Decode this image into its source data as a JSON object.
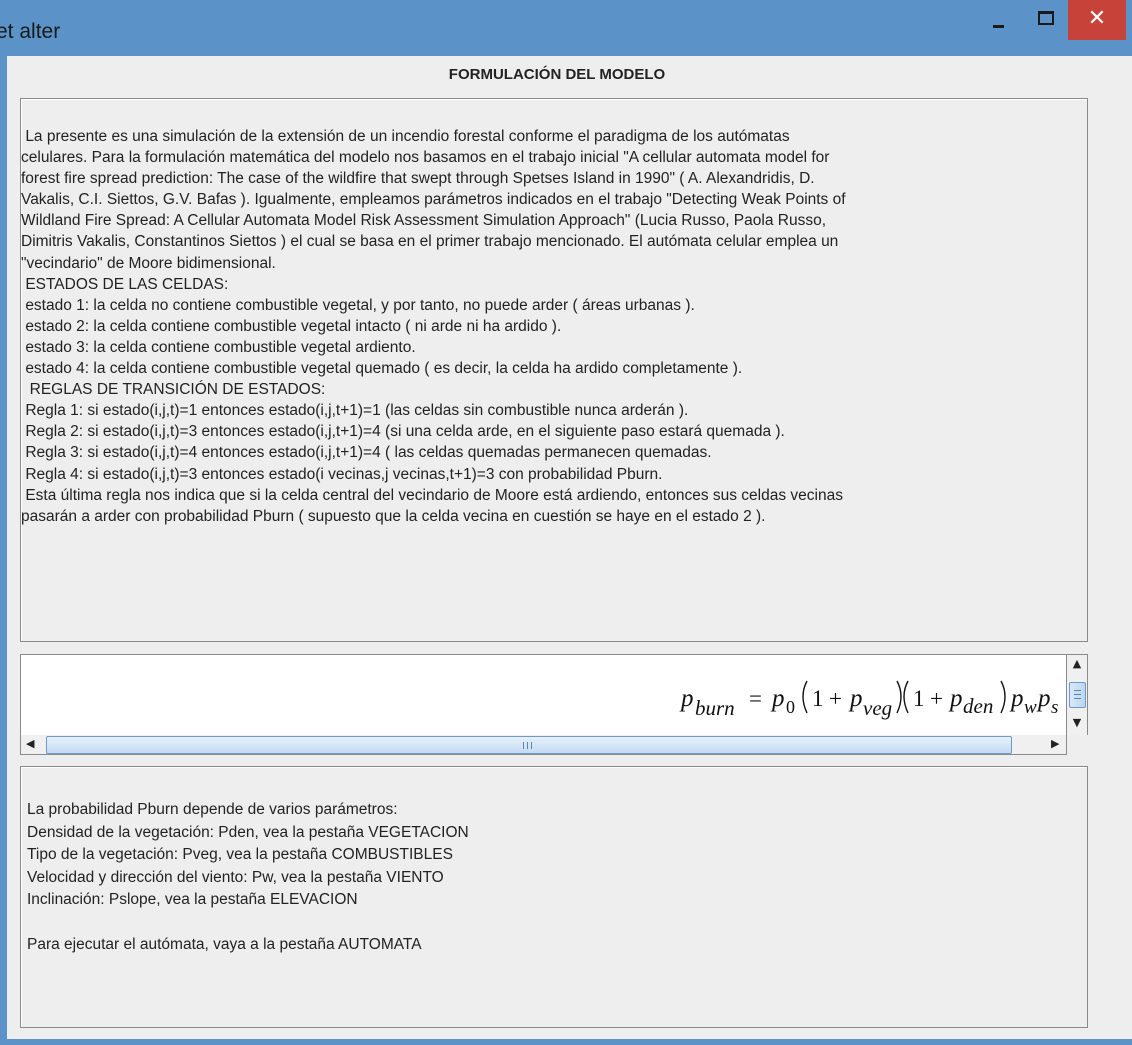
{
  "window": {
    "title": "et alter",
    "minimize_glyph": "−",
    "maximize_glyph": "□",
    "close_glyph": "✕",
    "close_color": "#c7433a",
    "frame_color": "#5b93c9"
  },
  "heading": "FORMULACIÓN DEL MODELO",
  "intro": {
    "lines": [
      " La presente es una simulación de la extensión de un incendio forestal conforme el paradigma de los autómatas",
      "celulares. Para la formulación matemática del modelo nos basamos en el trabajo inicial \"A cellular automata model for",
      "forest fire spread prediction: The case of the wildfire that swept through Spetses Island in 1990\" ( A. Alexandridis, D.",
      "Vakalis, C.I. Siettos, G.V. Bafas ). Igualmente, empleamos parámetros indicados en el trabajo \"Detecting Weak Points of",
      "Wildland Fire Spread: A Cellular Automata Model Risk Assessment Simulation Approach\" (Lucia Russo, Paola Russo,",
      "Dimitris Vakalis, Constantinos Siettos ) el cual se basa en el primer trabajo mencionado. El autómata celular emplea un",
      "\"vecindario\" de Moore bidimensional.",
      " ESTADOS DE LAS CELDAS:",
      " estado 1: la celda no contiene combustible vegetal, y por tanto, no puede arder ( áreas urbanas ).",
      " estado 2: la celda contiene combustible vegetal intacto ( ni arde ni ha ardido ).",
      " estado 3: la celda contiene combustible vegetal ardiento.",
      " estado 4: la celda contiene combustible vegetal quemado ( es decir, la celda ha ardido completamente ).",
      "  REGLAS DE TRANSICIÓN DE ESTADOS:",
      " Regla 1: si estado(i,j,t)=1 entonces estado(i,j,t+1)=1 (las celdas sin combustible nunca arderán ).",
      " Regla 2: si estado(i,j,t)=3 entonces estado(i,j,t+1)=4 (si una celda arde, en el siguiente paso estará quemada ).",
      " Regla 3: si estado(i,j,t)=4 entonces estado(i,j,t+1)=4 ( las celdas quemadas permanecen quemadas.",
      " Regla 4: si estado(i,j,t)=3 entonces estado(i vecinas,j vecinas,t+1)=3 con probabilidad Pburn.",
      " Esta última regla nos indica que si la celda central del vecindario de Moore está ardiendo, entonces sus celdas vecinas",
      "pasarán a arder con probabilidad Pburn ( supuesto que la celda vecina en cuestión se haye en el estado 2 )."
    ]
  },
  "formula": {
    "lhs_base": "p",
    "lhs_sub": "burn",
    "equals": "=",
    "p0_base": "p",
    "p0_sub": "0",
    "one_a": "1",
    "plus_a": "+",
    "pveg_base": "p",
    "pveg_sub": "veg",
    "one_b": "1",
    "plus_b": "+",
    "pden_base": "p",
    "pden_sub": "den",
    "pw_base": "p",
    "pw_sub": "w",
    "ps_base": "p",
    "ps_sub": "s"
  },
  "scrollbars": {
    "up_arrow": "▲",
    "down_arrow": "▼",
    "left_arrow": "◀",
    "right_arrow": "▶"
  },
  "info": {
    "lines": [
      "La probabilidad Pburn depende de varios parámetros:",
      "Densidad de la vegetación: Pden, vea la pestaña VEGETACION",
      "Tipo de la vegetación: Pveg, vea la pestaña COMBUSTIBLES",
      "Velocidad y dirección del viento: Pw, vea la pestaña VIENTO",
      "Inclinación: Pslope, vea la pestaña ELEVACION",
      "",
      "Para ejecutar el autómata, vaya a la pestaña AUTOMATA"
    ]
  }
}
